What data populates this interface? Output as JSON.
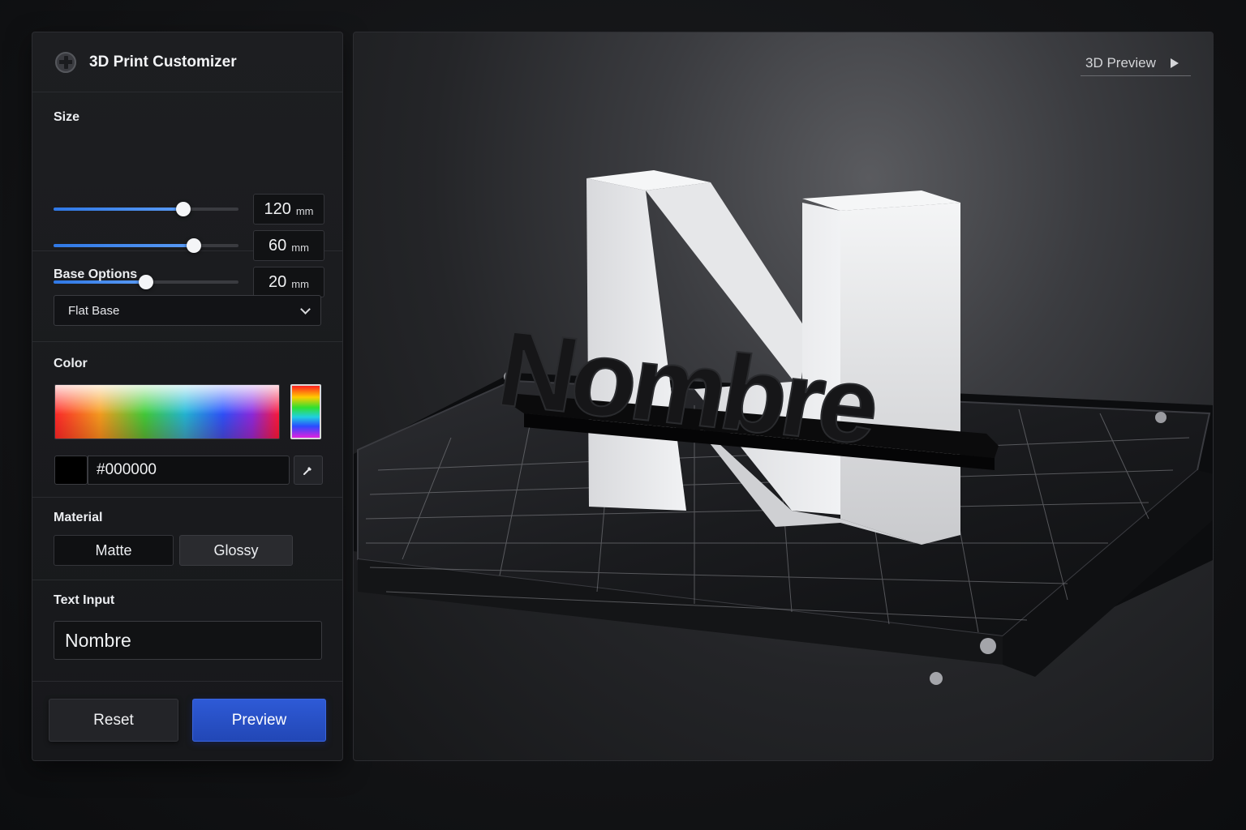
{
  "app": {
    "title": "3D Print Customizer",
    "logo_icon": "printer-logo-icon"
  },
  "size": {
    "label": "Size",
    "sliders": [
      {
        "value": "120",
        "unit": "mm",
        "fill_pct": 70
      },
      {
        "value": "60",
        "unit": "mm",
        "fill_pct": 76
      },
      {
        "value": "20",
        "unit": "mm",
        "fill_pct": 50
      }
    ]
  },
  "base": {
    "label": "Base Options",
    "selected": "Flat Base"
  },
  "color": {
    "label": "Color",
    "hex": "#000000",
    "swatch": "#000000"
  },
  "material": {
    "label": "Material",
    "options": [
      "Matte",
      "Glossy"
    ],
    "selected": "Matte"
  },
  "text_input": {
    "label": "Text Input",
    "value": "Nombre"
  },
  "actions": {
    "reset": "Reset",
    "preview": "Preview"
  },
  "preview": {
    "tab_label": "3D Preview",
    "model_text": "Nombre",
    "accent": "#2a4fc4"
  }
}
